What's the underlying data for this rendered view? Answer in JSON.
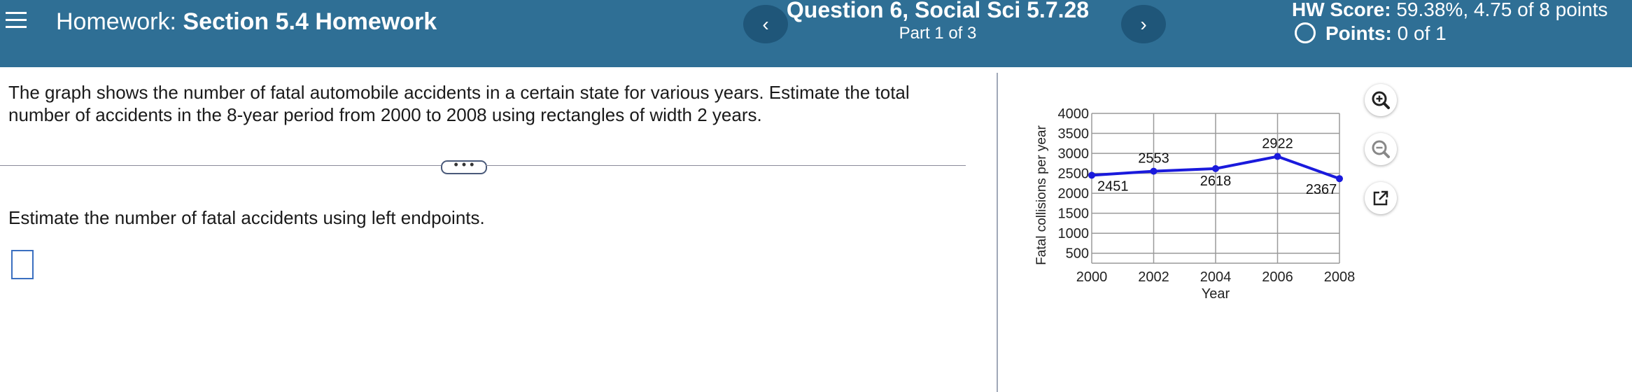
{
  "header": {
    "homework_prefix": "Homework:",
    "homework_name": "Section 5.4 Homework",
    "question_title": "Question 6, Social Sci 5.7.28",
    "part_text": "Part 1 of 3",
    "hw_score_label": "HW Score:",
    "hw_score_value": "59.38%, 4.75 of 8 points",
    "points_label": "Points:",
    "points_value": "0 of 1",
    "prev_icon": "chevron-left-icon",
    "next_icon": "chevron-right-icon",
    "menu_icon": "hamburger-menu-icon"
  },
  "problem": {
    "text": "The graph shows the number of fatal automobile accidents in a certain state for various years. Estimate the total number of accidents in the 8-year period from 2000 to 2008 using rectangles of width 2 years.",
    "expand_label": "• • •",
    "instruction": "Estimate the number of fatal accidents using left endpoints."
  },
  "answer": {
    "value": ""
  },
  "tools": {
    "zoom_in_icon": "zoom-in-icon",
    "zoom_out_icon": "zoom-out-icon",
    "popout_icon": "popout-icon"
  },
  "chart_data": {
    "type": "line",
    "x": [
      2000,
      2002,
      2004,
      2006,
      2008
    ],
    "values": [
      2451,
      2553,
      2618,
      2922,
      2367
    ],
    "data_labels": [
      "2451",
      "2553",
      "2618",
      "2922",
      "2367"
    ],
    "x_ticks": [
      "2000",
      "2002",
      "2004",
      "2006",
      "2008"
    ],
    "y_ticks": [
      "4000",
      "3500",
      "3000",
      "2500",
      "2000",
      "1500",
      "1000",
      "500"
    ],
    "xlabel": "Year",
    "ylabel": "Fatal collisions per year",
    "xlim": [
      2000,
      2008
    ],
    "ylim": [
      0,
      4000
    ],
    "grid": true,
    "line_color": "#1a1adc"
  }
}
